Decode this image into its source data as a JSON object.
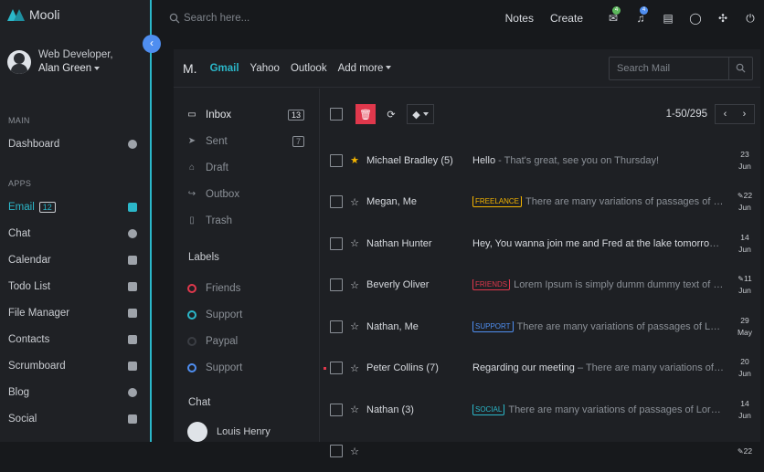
{
  "brand": "Mooli",
  "user": {
    "role": "Web Developer,",
    "name": "Alan Green"
  },
  "sidebar": {
    "main_header": "MAIN",
    "apps_header": "APPS",
    "main_items": [
      {
        "label": "Dashboard"
      }
    ],
    "apps_items": [
      {
        "label": "Email",
        "badge": "12"
      },
      {
        "label": "Chat"
      },
      {
        "label": "Calendar"
      },
      {
        "label": "Todo List"
      },
      {
        "label": "File Manager"
      },
      {
        "label": "Contacts"
      },
      {
        "label": "Scrumboard"
      },
      {
        "label": "Blog"
      },
      {
        "label": "Social"
      }
    ]
  },
  "topbar": {
    "search_placeholder": "Search here...",
    "notes": "Notes",
    "create": "Create",
    "mail_badge": "4",
    "bell_badge": "4"
  },
  "mail": {
    "brand": "M.",
    "tabs": [
      "Gmail",
      "Yahoo",
      "Outlook",
      "Add more"
    ],
    "search_placeholder": "Search Mail",
    "folders": [
      {
        "label": "Inbox",
        "count": "13"
      },
      {
        "label": "Sent",
        "count": "7"
      },
      {
        "label": "Draft",
        "count": ""
      },
      {
        "label": "Outbox",
        "count": ""
      },
      {
        "label": "Trash",
        "count": ""
      }
    ],
    "labels_header": "Labels",
    "labels": [
      {
        "label": "Friends",
        "color": "#e0384c"
      },
      {
        "label": "Support",
        "color": "#2bb7c9"
      },
      {
        "label": "Paypal",
        "color": "#3a3d43"
      },
      {
        "label": "Support",
        "color": "#4f8ef0"
      }
    ],
    "chat_header": "Chat",
    "chat_user": "Louis Henry",
    "pager": "1-50/295",
    "rows": [
      {
        "sender": "Michael Bradley (5)",
        "tag": "",
        "tag_color": "",
        "subject": "Hello",
        "preview": " - That's great, see you on Thursday!",
        "day": "23",
        "month": "Jun",
        "starred": true,
        "clip": false
      },
      {
        "sender": "Megan, Me",
        "tag": "FREELANCE",
        "tag_color": "#f4b400",
        "subject": "",
        "preview": "There are many variations of passages of Lorem Ipsum available",
        "day": "22",
        "month": "Jun",
        "starred": false,
        "clip": true
      },
      {
        "sender": "Nathan Hunter",
        "tag": "",
        "tag_color": "",
        "subject": "Hey, You wanna join me and Fred at the lake tomorrow? It'll be awesome.",
        "preview": "",
        "day": "14",
        "month": "Jun",
        "starred": false,
        "clip": false
      },
      {
        "sender": "Beverly Oliver",
        "tag": "FRIENDS",
        "tag_color": "#e0384c",
        "subject": "",
        "preview": "Lorem Ipsum is simply dumm dummy text of the printing industry",
        "day": "11",
        "month": "Jun",
        "starred": false,
        "clip": true
      },
      {
        "sender": "Nathan, Me",
        "tag": "SUPPORT",
        "tag_color": "#4f8ef0",
        "subject": "",
        "preview": "There are many variations of passages of Lorem Ipsum available",
        "day": "29",
        "month": "May",
        "starred": false,
        "clip": false
      },
      {
        "sender": "Peter Collins (7)",
        "tag": "",
        "tag_color": "",
        "subject": "Regarding our meeting",
        "preview": " – There are many variations of passages of Lorem Ipsum",
        "day": "20",
        "month": "Jun",
        "starred": false,
        "clip": false
      },
      {
        "sender": "Nathan (3)",
        "tag": "SOCIAL",
        "tag_color": "#2bb7c9",
        "subject": "",
        "preview": "There are many variations of passages of Lorem Ipsum available",
        "day": "14",
        "month": "Jun",
        "starred": false,
        "clip": false
      },
      {
        "sender": "",
        "tag": "",
        "tag_color": "",
        "subject": "",
        "preview": "",
        "day": "22",
        "month": "",
        "starred": false,
        "clip": true
      }
    ]
  }
}
